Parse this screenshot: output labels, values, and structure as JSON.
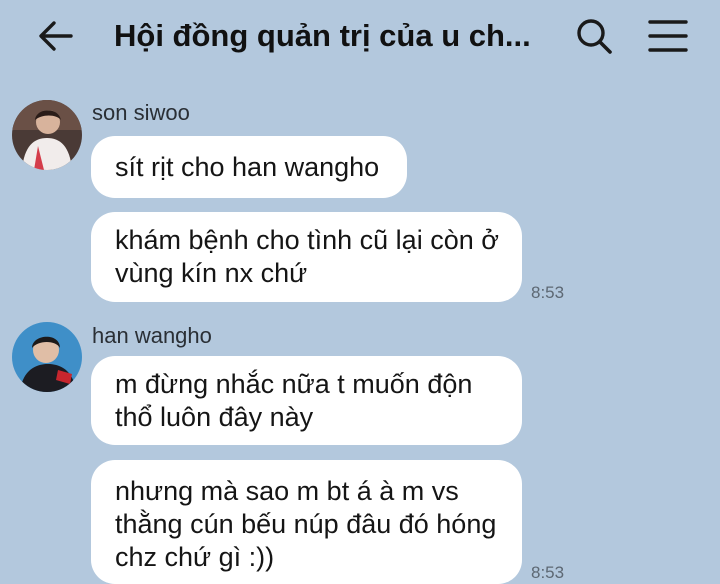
{
  "header": {
    "title": "Hội đồng quản trị của u ch...",
    "back_icon": "arrow-left-icon",
    "search_icon": "search-icon",
    "menu_icon": "menu-icon"
  },
  "messages": [
    {
      "sender": "son siwoo",
      "bubbles": [
        {
          "lines": [
            "sít rịt cho han wangho"
          ]
        },
        {
          "lines": [
            "khám bệnh cho tình cũ lại còn ở",
            "vùng kín nx chứ"
          ],
          "time": "8:53"
        }
      ]
    },
    {
      "sender": "han wangho",
      "bubbles": [
        {
          "lines": [
            "m đừng nhắc nữa t muốn độn",
            "thổ luôn đây này"
          ]
        },
        {
          "lines": [
            "nhưng mà sao m bt á à m vs",
            "thằng cún bếu núp đâu đó hóng",
            "chz chứ gì :))"
          ],
          "time": "8:53"
        }
      ]
    }
  ],
  "colors": {
    "background": "#b3c8dd",
    "bubble": "#ffffff",
    "timestamp": "#5d6873"
  }
}
